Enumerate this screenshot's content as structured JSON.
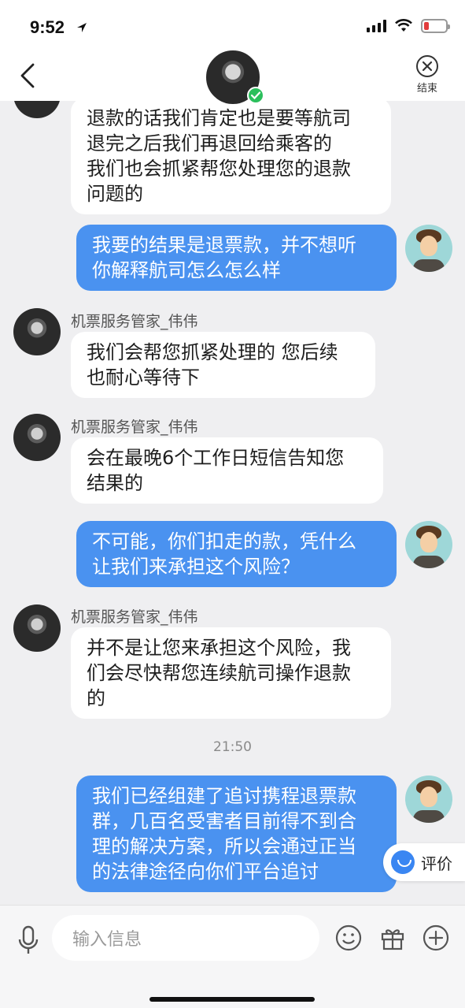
{
  "status_bar": {
    "time": "9:52"
  },
  "header": {
    "end_label": "结束"
  },
  "chat": {
    "messages": [
      {
        "from": "agent",
        "text": "退款的话我们肯定也是要等航司退完之后我们再退回给乘客的我们也会抓紧帮您处理您的退款问题的",
        "lines": [
          "退款的话我们肯定也是要等航司",
          "退完之后我们再退回给乘客的",
          "我们也会抓紧帮您处理您的退款",
          "问题的"
        ]
      },
      {
        "from": "user",
        "text": "我要的结果是退票款，并不想听你解释航司怎么怎么样",
        "lines": [
          "我要的结果是退票款，并不想听",
          "你解释航司怎么怎么样"
        ]
      },
      {
        "from": "agent",
        "sender": "机票服务管家_伟伟",
        "text": "我们会帮您抓紧处理的 您后续也耐心等待下",
        "lines": [
          "我们会帮您抓紧处理的 您后续",
          "也耐心等待下"
        ]
      },
      {
        "from": "agent",
        "sender": "机票服务管家_伟伟",
        "text": "会在最晚6个工作日短信告知您结果的",
        "lines": [
          "会在最晚6个工作日短信告知您",
          "结果的"
        ]
      },
      {
        "from": "user",
        "text": "不可能，你们扣走的款，凭什么让我们来承担这个风险？",
        "lines": [
          "不可能，你们扣走的款，凭什么",
          "让我们来承担这个风险？"
        ]
      },
      {
        "from": "agent",
        "sender": "机票服务管家_伟伟",
        "text": "并不是让您来承担这个风险，我们会尽快帮您连续航司操作退款的",
        "lines": [
          "并不是让您来承担这个风险，我",
          "们会尽快帮您连续航司操作退款",
          "的"
        ]
      },
      {
        "from": "user",
        "text": "我们已经组建了追讨携程退票款群，几百名受害者目前得不到合理的解决方案，所以会通过正当的法律途径向你们平台追讨",
        "lines": [
          "我们已经组建了追讨携程退票款",
          "群，几百名受害者目前得不到合",
          "理的解决方案，所以会通过正当",
          "的法律途径向你们平台追讨"
        ]
      }
    ],
    "timestamp": "21:50"
  },
  "rate_button": {
    "label": "评价"
  },
  "input_bar": {
    "placeholder": "输入信息"
  },
  "colors": {
    "user_bubble": "#4a92f0",
    "agent_bubble": "#ffffff",
    "background": "#efeff1",
    "battery_low": "#e23c3c",
    "verified": "#2bbf5c"
  },
  "icons": [
    "location-arrow-icon",
    "signal-icon",
    "wifi-icon",
    "battery-icon",
    "back-chevron-icon",
    "close-circle-icon",
    "microphone-icon",
    "emoji-icon",
    "gift-icon",
    "plus-circle-icon",
    "smile-rate-icon"
  ]
}
